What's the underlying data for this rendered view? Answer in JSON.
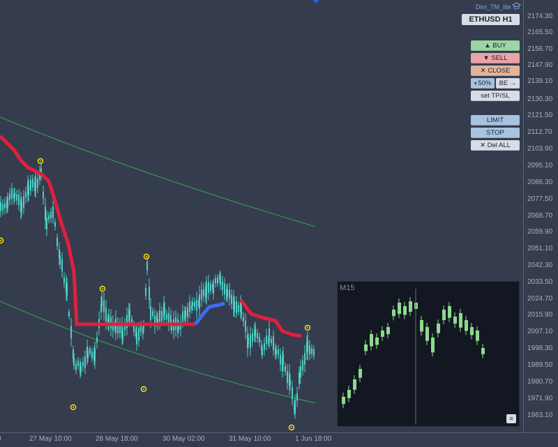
{
  "brand": {
    "label": "Dim_TM_lite"
  },
  "symbol": {
    "label": "ETHUSD H1"
  },
  "buttons": {
    "buy": "▲ BUY",
    "sell": "▼ SELL",
    "close": "✕ CLOSE",
    "half": "◐50%",
    "be": "BE →",
    "settpsl": "set TP/SL",
    "limit": "LIMIT",
    "stop": "STOP",
    "delall": "✕ Del ALL"
  },
  "colors": {
    "background": "#353c4e",
    "candle": "#4fd1c7",
    "trail_red": "#e0203c",
    "trail_blue": "#3a6ff0",
    "channel_green": "#2faa4a",
    "marker_yellow": "#ffe600",
    "buy_btn": "#9bd6a0",
    "sell_btn": "#e8a4a8",
    "close_btn": "#e3b49a",
    "blue_btn": "#a9c2de",
    "neutral_btn": "#d8dce6"
  },
  "price_axis": {
    "labels": [
      "2174.30",
      "2165.50",
      "2156.70",
      "2147.90",
      "2139.10",
      "2130.30",
      "2121.50",
      "2112.70",
      "2103.90",
      "2095.10",
      "2086.30",
      "2077.50",
      "2068.70",
      "2059.90",
      "2051.10",
      "2042.30",
      "2033.50",
      "2024.70",
      "2015.90",
      "2007.10",
      "1998.30",
      "1989.50",
      "1980.70",
      "1971.90",
      "1963.10"
    ]
  },
  "time_axis": {
    "labels": [
      "0",
      "27 May 10:00",
      "28 May 18:00",
      "30 May 02:00",
      "31 May 10:00",
      "1 Jun 18:00"
    ]
  },
  "mini_chart": {
    "title": "M15",
    "menu_icon": "≡"
  }
}
